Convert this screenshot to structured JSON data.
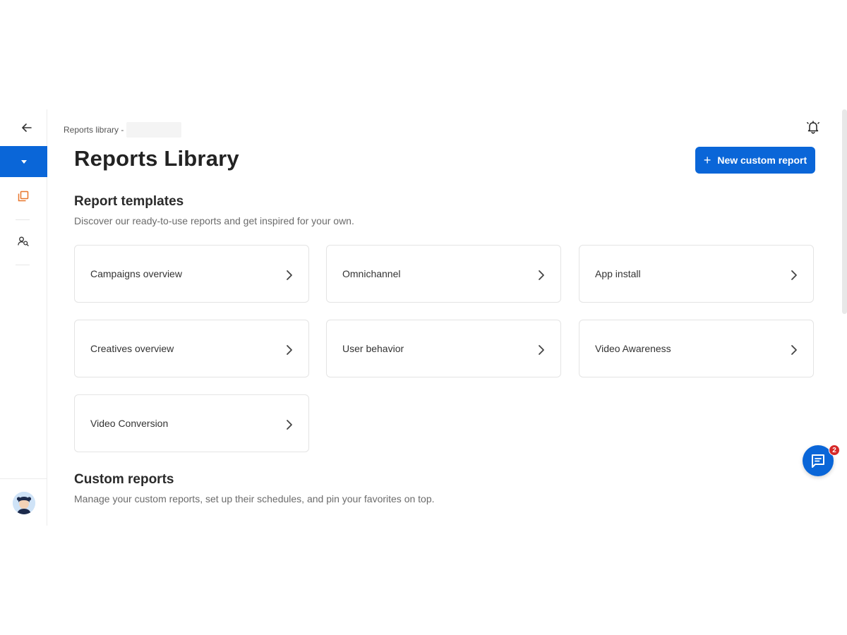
{
  "breadcrumb": {
    "text": "Reports library -"
  },
  "header": {
    "title": "Reports Library",
    "new_button_label": "New custom report",
    "new_button_icon": "plus-icon"
  },
  "templates": {
    "title": "Report templates",
    "description": "Discover our ready-to-use reports and get inspired for your own.",
    "cards": [
      {
        "label": "Campaigns overview"
      },
      {
        "label": "Omnichannel"
      },
      {
        "label": "App install"
      },
      {
        "label": "Creatives overview"
      },
      {
        "label": "User behavior"
      },
      {
        "label": "Video Awareness"
      },
      {
        "label": "Video Conversion"
      }
    ]
  },
  "custom": {
    "title": "Custom reports",
    "description": "Manage your custom reports, set up their schedules, and pin your favorites on top."
  },
  "sidebar": {
    "icons": [
      "arrow-left-icon",
      "caret-down-icon",
      "reports-library-icon",
      "user-search-icon"
    ]
  },
  "chat": {
    "badge_count": "2"
  },
  "colors": {
    "primary": "#0a66d8",
    "accent_orange": "#e8762c",
    "badge_red": "#d62a2a"
  }
}
